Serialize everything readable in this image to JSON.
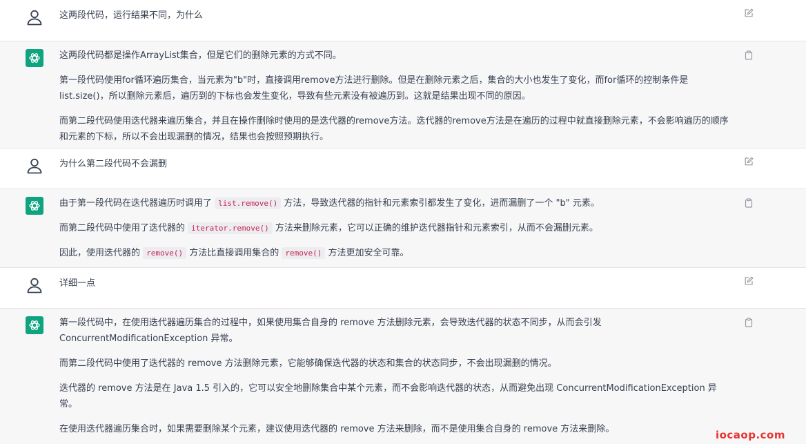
{
  "colors": {
    "assistant_bg": "#f7f7f8",
    "user_bg": "#ffffff",
    "gpt_green": "#10a37f",
    "code_text": "#c7254e",
    "watermark": "#e8322f"
  },
  "messages": [
    {
      "role": "user",
      "avatar_icon": "user-icon",
      "action_icon": "edit-icon",
      "paragraphs": [
        "这两段代码，运行结果不同，为什么"
      ]
    },
    {
      "role": "assistant",
      "avatar_icon": "chatgpt-logo-icon",
      "action_icon": "copy-icon",
      "paragraphs": [
        "这两段代码都是操作ArrayList集合，但是它们的删除元素的方式不同。",
        "第一段代码使用for循环遍历集合，当元素为\"b\"时，直接调用remove方法进行删除。但是在删除元素之后，集合的大小也发生了变化，而for循环的控制条件是list.size()，所以删除元素后，遍历到的下标也会发生变化，导致有些元素没有被遍历到。这就是结果出现不同的原因。",
        "而第二段代码使用迭代器来遍历集合，并且在操作删除时使用的是迭代器的remove方法。迭代器的remove方法是在遍历的过程中就直接删除元素，不会影响遍历的顺序和元素的下标，所以不会出现漏删的情况，结果也会按照预期执行。"
      ]
    },
    {
      "role": "user",
      "avatar_icon": "user-icon",
      "action_icon": "edit-icon",
      "paragraphs": [
        "为什么第二段代码不会漏删"
      ]
    },
    {
      "role": "assistant",
      "avatar_icon": "chatgpt-logo-icon",
      "action_icon": "copy-icon",
      "rich": [
        {
          "pre": "由于第一段代码在迭代器遍历时调用了 ",
          "code": "list.remove()",
          "post": " 方法，导致迭代器的指针和元素索引都发生了变化，进而漏删了一个 \"b\" 元素。"
        },
        {
          "pre": "而第二段代码中使用了迭代器的 ",
          "code": "iterator.remove()",
          "post": " 方法来删除元素，它可以正确的维护迭代器指针和元素索引，从而不会漏删元素。"
        },
        {
          "pre": "因此，使用迭代器的 ",
          "code": "remove()",
          "mid": " 方法比直接调用集合的 ",
          "code2": "remove()",
          "post": " 方法更加安全可靠。"
        }
      ]
    },
    {
      "role": "user",
      "avatar_icon": "user-icon",
      "action_icon": "edit-icon",
      "paragraphs": [
        "详细一点"
      ]
    },
    {
      "role": "assistant",
      "avatar_icon": "chatgpt-logo-icon",
      "action_icon": "copy-icon",
      "paragraphs": [
        "第一段代码中，在使用迭代器遍历集合的过程中，如果使用集合自身的 remove 方法删除元素，会导致迭代器的状态不同步，从而会引发 ConcurrentModificationException 异常。",
        "而第二段代码中使用了迭代器的 remove 方法删除元素，它能够确保迭代器的状态和集合的状态同步，不会出现漏删的情况。",
        "迭代器的 remove 方法是在 Java 1.5 引入的，它可以安全地删除集合中某个元素，而不会影响迭代器的状态，从而避免出现 ConcurrentModificationException 异常。",
        "在使用迭代器遍历集合时，如果需要删除某个元素，建议使用迭代器的 remove 方法来删除，而不是使用集合自身的 remove 方法来删除。"
      ]
    }
  ],
  "watermark": "iocaop.com"
}
